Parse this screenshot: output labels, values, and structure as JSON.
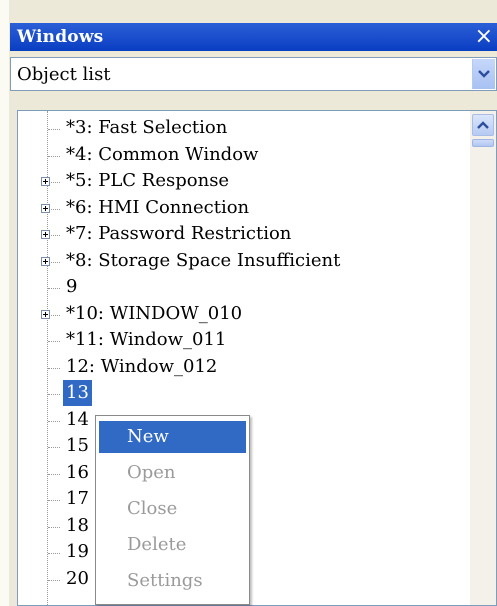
{
  "window": {
    "title": "Windows",
    "close_glyph": "×"
  },
  "combo": {
    "value": "Object list"
  },
  "tree": {
    "items": [
      {
        "label": "*3: Fast Selection",
        "expandable": false
      },
      {
        "label": "*4: Common Window",
        "expandable": false
      },
      {
        "label": "*5: PLC Response",
        "expandable": true
      },
      {
        "label": "*6: HMI Connection",
        "expandable": true
      },
      {
        "label": "*7: Password Restriction",
        "expandable": true
      },
      {
        "label": "*8: Storage Space Insufficient",
        "expandable": true
      },
      {
        "label": "9",
        "expandable": false
      },
      {
        "label": "*10: WINDOW_010",
        "expandable": true
      },
      {
        "label": "*11: Window_011",
        "expandable": false
      },
      {
        "label": "12: Window_012",
        "expandable": false
      },
      {
        "label": "13",
        "expandable": false,
        "selected": true
      },
      {
        "label": "14",
        "expandable": false
      },
      {
        "label": "15",
        "expandable": false
      },
      {
        "label": "16",
        "expandable": false
      },
      {
        "label": "17",
        "expandable": false
      },
      {
        "label": "18",
        "expandable": false
      },
      {
        "label": "19",
        "expandable": false
      },
      {
        "label": "20",
        "expandable": false
      }
    ]
  },
  "context_menu": {
    "items": [
      {
        "label": "New",
        "state": "active"
      },
      {
        "label": "Open",
        "state": "disabled"
      },
      {
        "label": "Close",
        "state": "disabled"
      },
      {
        "label": "Delete",
        "state": "disabled"
      },
      {
        "label": "Settings",
        "state": "disabled"
      }
    ]
  }
}
